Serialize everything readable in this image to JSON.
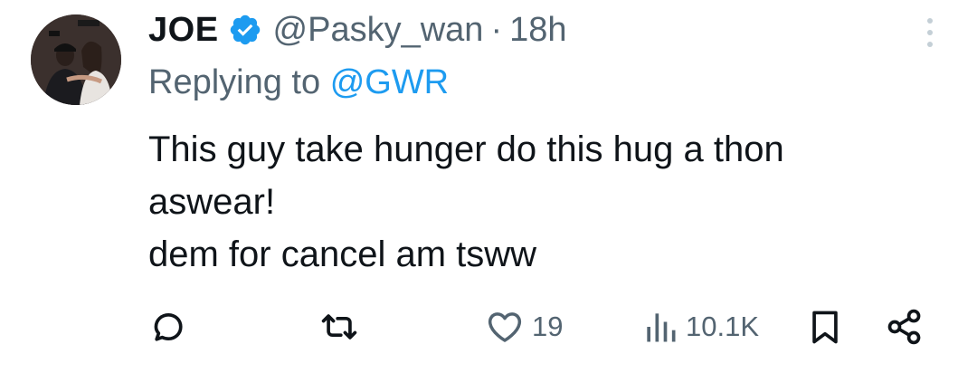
{
  "tweet": {
    "display_name": "JOE",
    "verified": true,
    "handle": "@Pasky_wan",
    "separator": "·",
    "time": "18h",
    "replying_prefix": "Replying to",
    "replying_to": "@GWR",
    "text_lines": [
      "This guy take hunger do this hug a thon",
      "aswear!",
      "dem for cancel am tsww"
    ]
  },
  "actions": {
    "reply_count": "",
    "retweet_count": "",
    "like_count": "19",
    "views_count": "10.1K"
  },
  "icons": {
    "verified": "verified-badge-icon",
    "more": "more-vertical-icon",
    "reply": "reply-bubble-icon",
    "retweet": "retweet-icon",
    "like": "heart-icon",
    "views": "bar-chart-icon",
    "bookmark": "bookmark-icon",
    "share": "share-icon"
  },
  "colors": {
    "text": "#0f1419",
    "secondary": "#536471",
    "accent": "#1d9bf0"
  }
}
